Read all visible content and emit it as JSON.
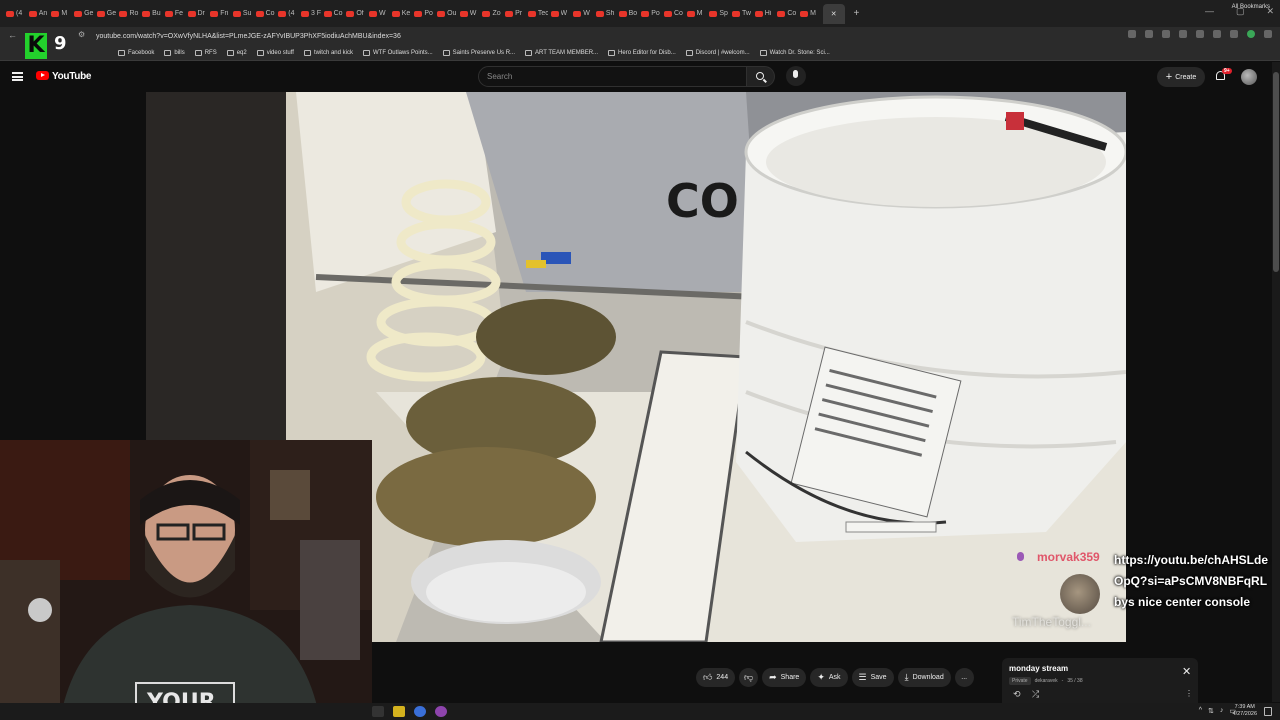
{
  "browser": {
    "tabs": [
      "(4",
      "An",
      "M",
      "Ge",
      "Ge",
      "Ro",
      "Bu",
      "Fe",
      "Dr",
      "Fri",
      "Su",
      "Co",
      "(4",
      "3 F",
      "Co",
      "Of",
      "W",
      "Ke",
      "Po",
      "Ou",
      "W",
      "Zo",
      "Pr",
      "Tec",
      "W",
      "W",
      "Sh",
      "Bo",
      "Po",
      "Co",
      "M",
      "Sp",
      "Tw",
      "Hi",
      "Co",
      "M"
    ],
    "address": "youtube.com/watch?v=OXwVfyNLHA&list=PLmeJGE-zAFYvIBUP3PhXF5iodiuAchMBU&index=36",
    "bookmarks": [
      {
        "label": "Facebook",
        "icon": "facebook-icon"
      },
      {
        "label": "bills",
        "icon": "folder-icon"
      },
      {
        "label": "RFS",
        "icon": "folder-icon"
      },
      {
        "label": "eq2",
        "icon": "folder-icon"
      },
      {
        "label": "video stuff",
        "icon": "folder-icon"
      },
      {
        "label": "twitch and kick",
        "icon": "folder-icon"
      },
      {
        "label": "WTF Outlaws Points...",
        "icon": "page-icon"
      },
      {
        "label": "Saints Preserve Us R...",
        "icon": "page-icon"
      },
      {
        "label": "ART TEAM MEMBER...",
        "icon": "page-icon"
      },
      {
        "label": "Hero Editor for Disb...",
        "icon": "page-icon"
      },
      {
        "label": "Discord | #welcom...",
        "icon": "discord-icon"
      },
      {
        "label": "Watch Dr. Stone: Sci...",
        "icon": "page-icon"
      }
    ],
    "all_bookmarks": "All Bookmarks",
    "colors": {
      "tab_favicon": "#e8352a",
      "profile": "#3aa757"
    }
  },
  "overlay_logo": {
    "letter": "K",
    "number": "9"
  },
  "youtube": {
    "logo_text": "YouTube",
    "search_placeholder": "Search",
    "create_label": "Create",
    "notification_badge": "9+",
    "colors": {
      "brand": "#ff0000",
      "badge": "#e0202b"
    }
  },
  "chat": {
    "user": "morvak359",
    "message": "https://youtu.be/chAHSLdeOpQ?si=aPsCMV8NBFqRLbys nice center console",
    "ghost_user": "TimTheToggl...",
    "colors": {
      "username": "#e0566a"
    }
  },
  "webcam": {
    "shirt_text": "YOUR"
  },
  "actions": {
    "likes": "244",
    "share": "Share",
    "ask": "Ask",
    "save": "Save",
    "download": "Download",
    "more": "..."
  },
  "playlist": {
    "title": "monday stream",
    "privacy": "Private",
    "owner": "dekaravek",
    "position": "35 / 38"
  },
  "taskbar": {
    "time": "7:39 AM",
    "date": "4/27/2026"
  }
}
